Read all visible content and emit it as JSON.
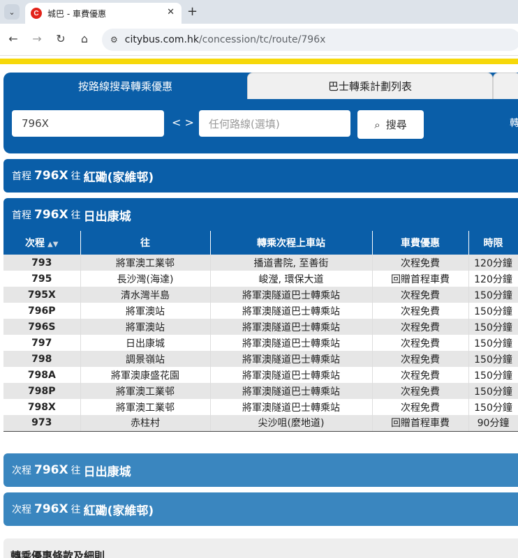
{
  "browser": {
    "tab_title": "城巴 - 車費優惠",
    "favicon_letter": "C",
    "url_host": "citybus.com.hk",
    "url_path": "/concession/tc/route/796x"
  },
  "search_panel": {
    "tabs": [
      "按路線搜尋轉乘優惠",
      "巴士轉乘計劃列表"
    ],
    "route_input_value": "796X",
    "swap_symbol": "< >",
    "second_route_placeholder": "任何路線(選填)",
    "search_button_label": "搜尋",
    "cut_label": "轉"
  },
  "sections": [
    {
      "prefix": "首程",
      "route": "796X",
      "to": "往",
      "destination": "紅磡(家維邨)"
    },
    {
      "prefix": "首程",
      "route": "796X",
      "to": "往",
      "destination": "日出康城"
    },
    {
      "prefix": "次程",
      "route": "796X",
      "to": "往",
      "destination": "日出康城"
    },
    {
      "prefix": "次程",
      "route": "796X",
      "to": "往",
      "destination": "紅磡(家維邨)"
    }
  ],
  "table": {
    "headers": [
      "次程",
      "往",
      "轉乘次程上車站",
      "車費優惠",
      "時限"
    ],
    "rows": [
      [
        "793",
        "將軍澳工業邨",
        "播道書院, 至善街",
        "次程免費",
        "120分鐘"
      ],
      [
        "795",
        "長沙灣(海達)",
        "峻瀅, 環保大道",
        "回贈首程車費",
        "120分鐘"
      ],
      [
        "795X",
        "清水灣半島",
        "將軍澳隧道巴士轉乘站",
        "次程免費",
        "150分鐘"
      ],
      [
        "796P",
        "將軍澳站",
        "將軍澳隧道巴士轉乘站",
        "次程免費",
        "150分鐘"
      ],
      [
        "796S",
        "將軍澳站",
        "將軍澳隧道巴士轉乘站",
        "次程免費",
        "150分鐘"
      ],
      [
        "797",
        "日出康城",
        "將軍澳隧道巴士轉乘站",
        "次程免費",
        "150分鐘"
      ],
      [
        "798",
        "調景嶺站",
        "將軍澳隧道巴士轉乘站",
        "次程免費",
        "150分鐘"
      ],
      [
        "798A",
        "將軍澳康盛花園",
        "將軍澳隧道巴士轉乘站",
        "次程免費",
        "150分鐘"
      ],
      [
        "798P",
        "將軍澳工業邨",
        "將軍澳隧道巴士轉乘站",
        "次程免費",
        "150分鐘"
      ],
      [
        "798X",
        "將軍澳工業邨",
        "將軍澳隧道巴士轉乘站",
        "次程免費",
        "150分鐘"
      ],
      [
        "973",
        "赤柱村",
        "尖沙咀(麼地道)",
        "回贈首程車費",
        "90分鐘"
      ]
    ]
  },
  "terms_heading": "轉乘優惠條款及細則",
  "colors": {
    "primary": "#0a5ea8",
    "secondary": "#3a86bf",
    "accent_bar": "#f6d80a"
  }
}
